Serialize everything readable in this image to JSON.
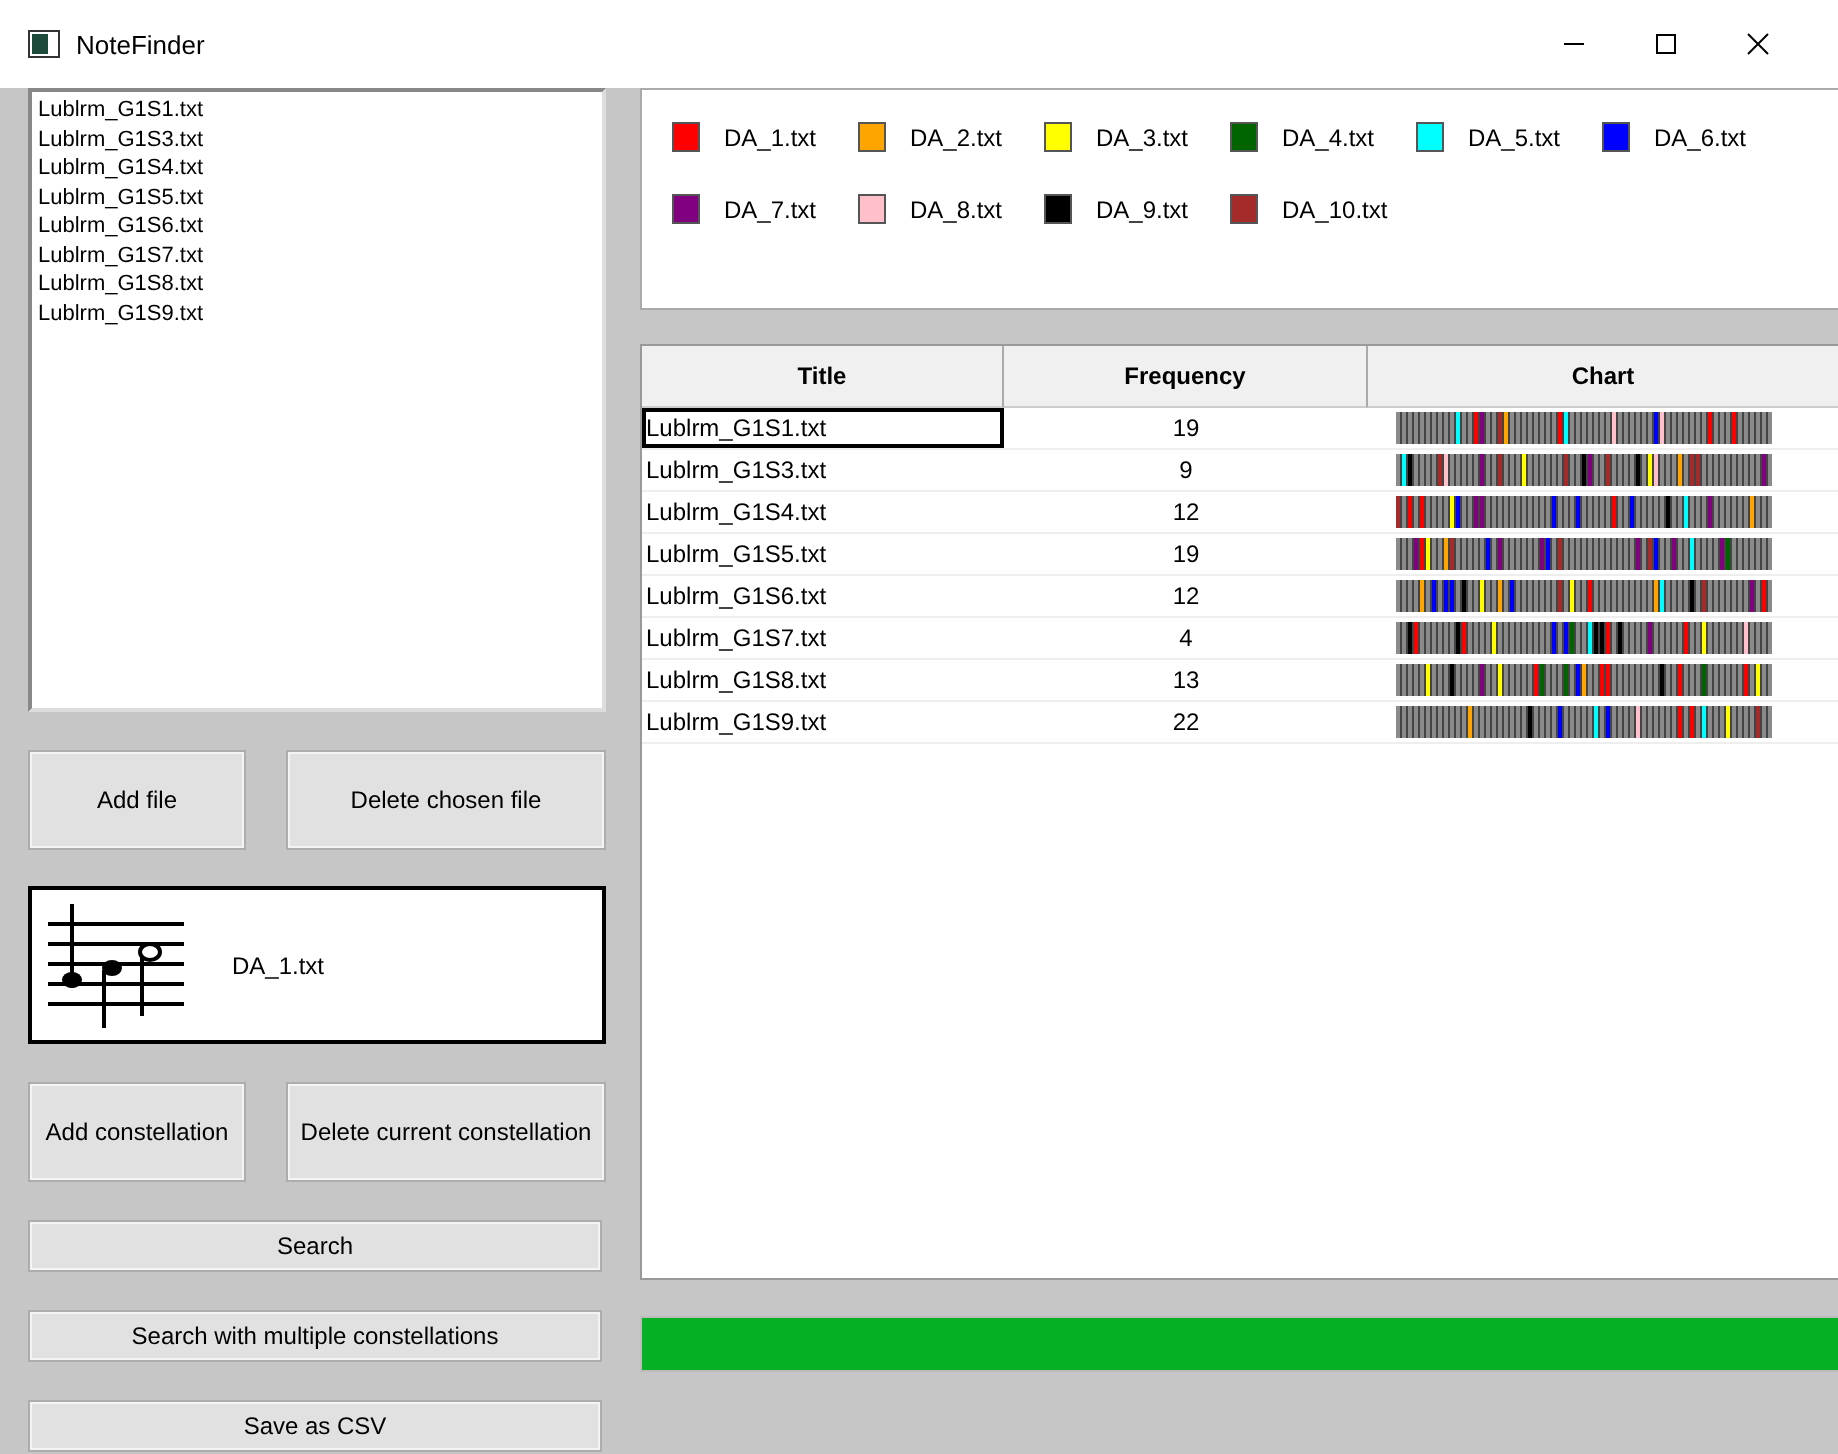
{
  "window": {
    "title": "NoteFinder"
  },
  "files": [
    {
      "label": "Lublrm_G1S1.txt"
    },
    {
      "label": "Lublrm_G1S3.txt"
    },
    {
      "label": "Lublrm_G1S4.txt"
    },
    {
      "label": "Lublrm_G1S5.txt"
    },
    {
      "label": "Lublrm_G1S6.txt"
    },
    {
      "label": "Lublrm_G1S7.txt"
    },
    {
      "label": "Lublrm_G1S8.txt"
    },
    {
      "label": "Lublrm_G1S9.txt"
    }
  ],
  "file_buttons": [
    "Add file",
    "Delete chosen file"
  ],
  "constellation": {
    "label": "DA_1.txt"
  },
  "constellation_buttons": [
    "Add constellation",
    "Delete current constellation"
  ],
  "actions": [
    "Search",
    "Search with multiple constellations",
    "Save as CSV"
  ],
  "legend": [
    {
      "label": "DA_1.txt",
      "color": "#ff0000"
    },
    {
      "label": "DA_2.txt",
      "color": "#ffa500"
    },
    {
      "label": "DA_3.txt",
      "color": "#ffff00"
    },
    {
      "label": "DA_4.txt",
      "color": "#006400"
    },
    {
      "label": "DA_5.txt",
      "color": "#00ffff"
    },
    {
      "label": "DA_6.txt",
      "color": "#0000ff"
    },
    {
      "label": "DA_7.txt",
      "color": "#800080"
    },
    {
      "label": "DA_8.txt",
      "color": "#ffc0cb"
    },
    {
      "label": "DA_9.txt",
      "color": "#000000"
    },
    {
      "label": "DA_10.txt",
      "color": "#a52a2a"
    }
  ],
  "table": {
    "columns": [
      "Title",
      "Frequency",
      "Chart"
    ],
    "rows": [
      {
        "title": "Lublrm_G1S1.txt",
        "frequency": "19",
        "selected": true
      },
      {
        "title": "Lublrm_G1S3.txt",
        "frequency": "9",
        "selected": false
      },
      {
        "title": "Lublrm_G1S4.txt",
        "frequency": "12",
        "selected": false
      },
      {
        "title": "Lublrm_G1S5.txt",
        "frequency": "19",
        "selected": false
      },
      {
        "title": "Lublrm_G1S6.txt",
        "frequency": "12",
        "selected": false
      },
      {
        "title": "Lublrm_G1S7.txt",
        "frequency": "4",
        "selected": false
      },
      {
        "title": "Lublrm_G1S8.txt",
        "frequency": "13",
        "selected": false
      },
      {
        "title": "Lublrm_G1S9.txt",
        "frequency": "22",
        "selected": false
      }
    ]
  },
  "progress": {
    "level": 1
  }
}
